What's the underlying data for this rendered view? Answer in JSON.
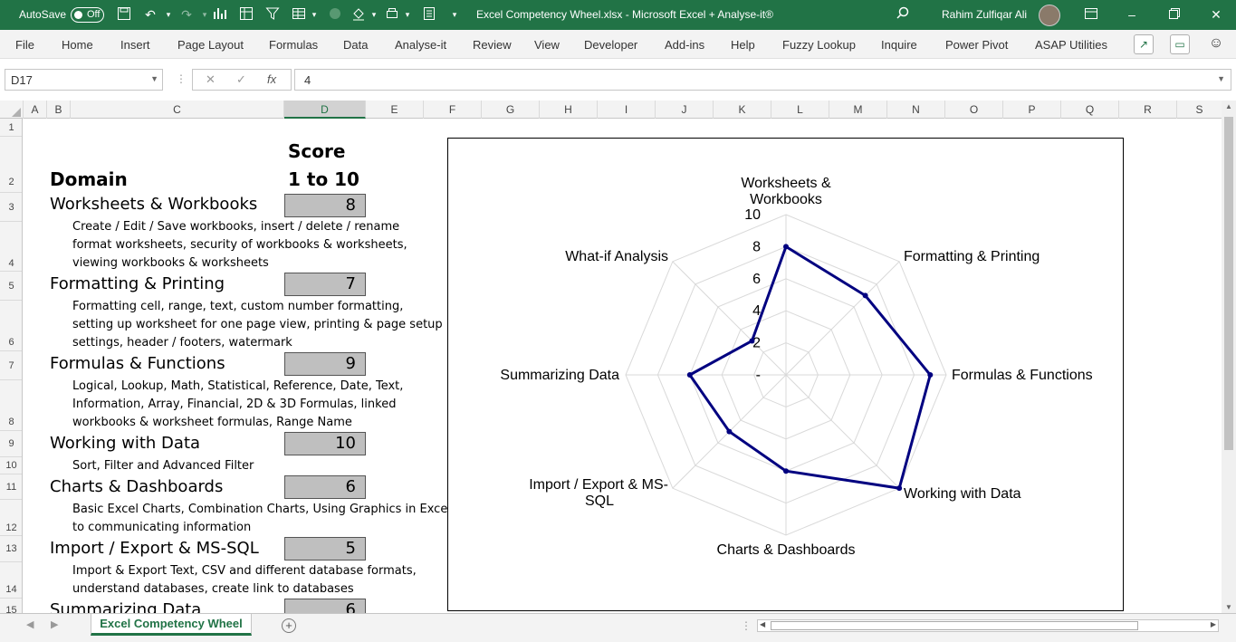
{
  "titlebar": {
    "autosave_label": "AutoSave",
    "autosave_state": "Off",
    "doc_title": "Excel Competency Wheel.xlsx  -  Microsoft Excel + Analyse-it®",
    "user_name": "Rahim Zulfiqar Ali",
    "accent_color": "#217346"
  },
  "menu": [
    "File",
    "Home",
    "Insert",
    "Page Layout",
    "Formulas",
    "Data",
    "Analyse-it",
    "Review",
    "View",
    "Developer",
    "Add-ins",
    "Help",
    "Fuzzy Lookup",
    "Inquire",
    "Power Pivot",
    "ASAP Utilities"
  ],
  "formula_bar": {
    "name_box": "D17",
    "cancel": "✕",
    "enter": "✓",
    "fx": "fx",
    "value": "4"
  },
  "columns": [
    "A",
    "B",
    "C",
    "D",
    "E",
    "F",
    "G",
    "H",
    "I",
    "J",
    "K",
    "L",
    "M",
    "N",
    "O",
    "P",
    "Q",
    "R",
    "S"
  ],
  "selected_column": "D",
  "rows": [
    "1",
    "2",
    "3",
    "4",
    "5",
    "6",
    "7",
    "8",
    "9",
    "10",
    "11",
    "12",
    "13",
    "14",
    "15"
  ],
  "sheet": {
    "header_domain": "Domain",
    "header_score_1": "Score",
    "header_score_2": "1 to 10",
    "domains": [
      {
        "name": "Worksheets & Workbooks",
        "score": "8",
        "desc": [
          "Create / Edit / Save workbooks, insert / delete / rename",
          "format worksheets, security of workbooks & worksheets,",
          "viewing workbooks & worksheets"
        ]
      },
      {
        "name": "Formatting & Printing",
        "score": "7",
        "desc": [
          "Formatting cell, range, text, custom number formatting,",
          "setting up worksheet for one page view, printing & page setup",
          "settings, header / footers, watermark"
        ]
      },
      {
        "name": "Formulas & Functions",
        "score": "9",
        "desc": [
          "Logical, Lookup, Math, Statistical, Reference, Date, Text,",
          "Information, Array, Financial, 2D & 3D Formulas, linked",
          "workbooks & worksheet formulas, Range Name"
        ]
      },
      {
        "name": "Working with Data",
        "score": "10",
        "desc": [
          "Sort, Filter and Advanced Filter"
        ]
      },
      {
        "name": "Charts & Dashboards",
        "score": "6",
        "desc": [
          "Basic Excel Charts, Combination Charts, Using Graphics in Excel",
          "to communicating information"
        ]
      },
      {
        "name": "Import / Export & MS-SQL",
        "score": "5",
        "desc": [
          "Import & Export Text, CSV and different database formats,",
          "understand databases, create link to databases"
        ]
      },
      {
        "name": "Summarizing Data",
        "score": "6",
        "desc": []
      }
    ]
  },
  "chart_data": {
    "type": "radar",
    "categories": [
      "Worksheets & Workbooks",
      "Formatting & Printing",
      "Formulas & Functions",
      "Working with Data",
      "Charts & Dashboards",
      "Import / Export & MS-SQL",
      "Summarizing Data",
      "What-if Analysis"
    ],
    "values": [
      8,
      7,
      9,
      10,
      6,
      5,
      6,
      3
    ],
    "rmax": 10,
    "ticks": [
      "-",
      "2",
      "4",
      "6",
      "8",
      "10"
    ],
    "series_color": "#000080",
    "grid": true
  },
  "tabs": {
    "active": "Excel Competency Wheel",
    "add_label": "+"
  }
}
